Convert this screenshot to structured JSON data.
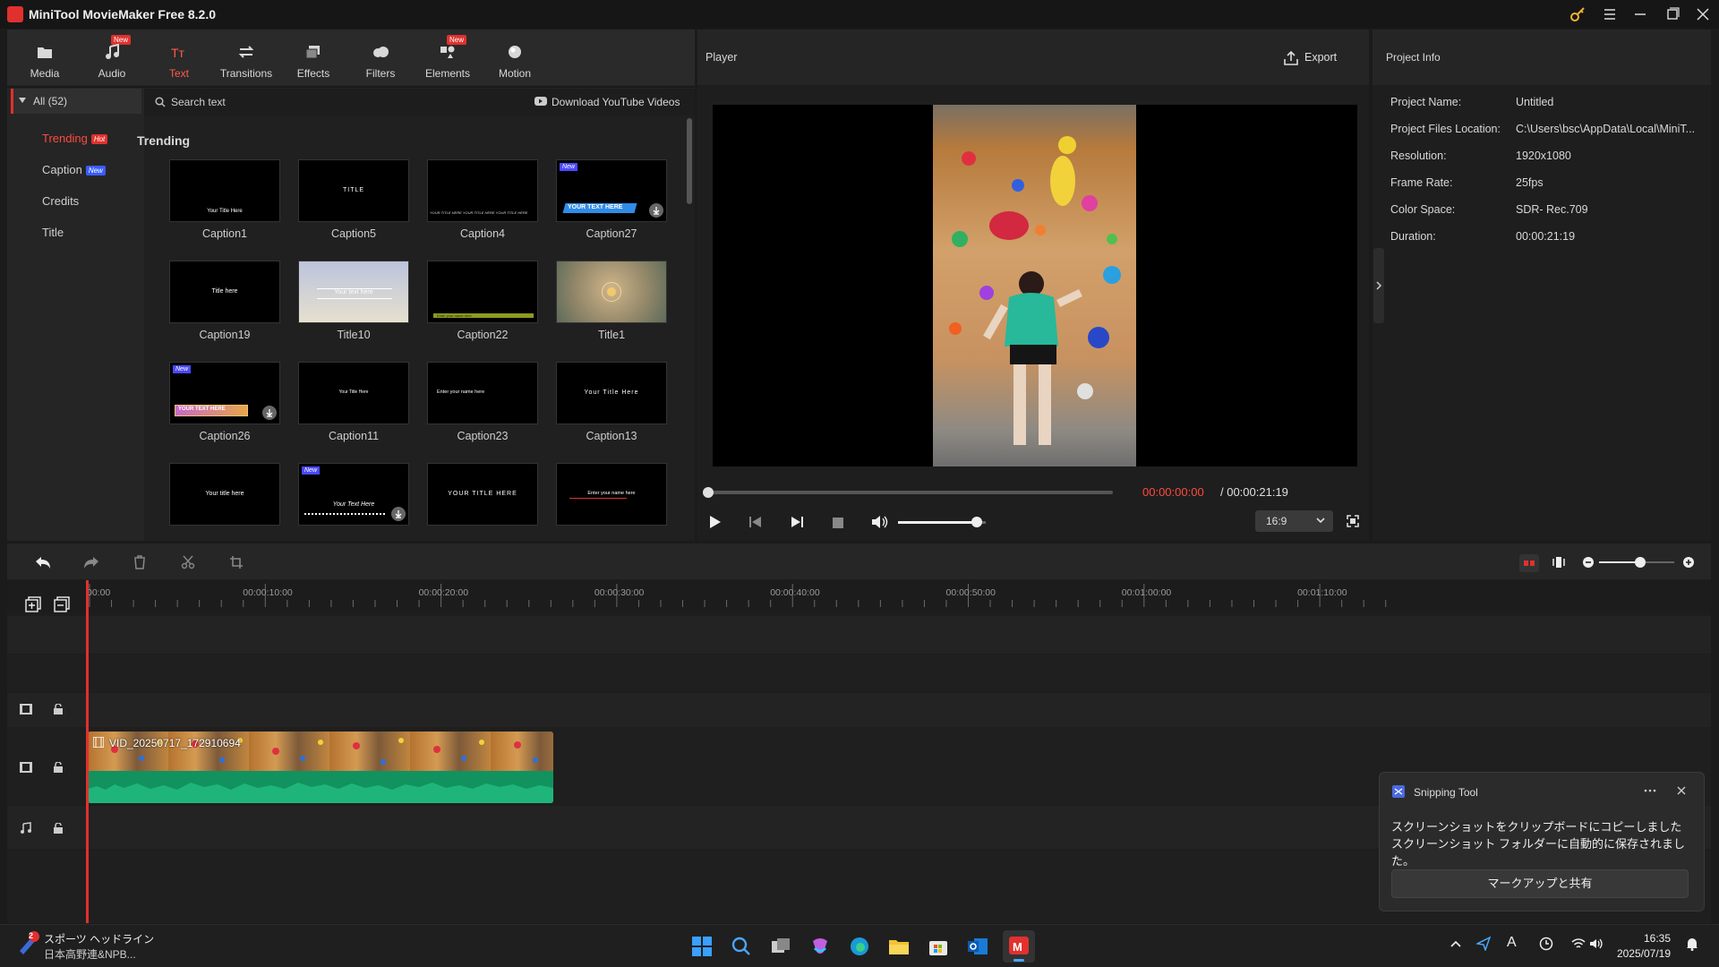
{
  "app": {
    "title": "MiniTool MovieMaker Free 8.2.0"
  },
  "toolbar": {
    "tabs": [
      {
        "label": "Media",
        "icon": "folder-icon",
        "new": false
      },
      {
        "label": "Audio",
        "icon": "music-note-icon",
        "new": true
      },
      {
        "label": "Text",
        "icon": "text-icon",
        "new": false,
        "active": true
      },
      {
        "label": "Transitions",
        "icon": "swap-arrows-icon",
        "new": false
      },
      {
        "label": "Effects",
        "icon": "layers-icon",
        "new": false
      },
      {
        "label": "Filters",
        "icon": "cloud-icon",
        "new": false
      },
      {
        "label": "Elements",
        "icon": "shapes-icon",
        "new": true
      },
      {
        "label": "Motion",
        "icon": "sphere-icon",
        "new": false
      }
    ],
    "new_badge": "New"
  },
  "library": {
    "category_all": "All (52)",
    "categories": [
      {
        "label": "Trending",
        "badge": "Hot"
      },
      {
        "label": "Caption",
        "badge": "New"
      },
      {
        "label": "Credits",
        "badge": ""
      },
      {
        "label": "Title",
        "badge": ""
      }
    ],
    "search_placeholder": "Search text",
    "download_link": "Download YouTube Videos",
    "section_heading": "Trending",
    "items": [
      {
        "label": "Caption1",
        "preview": "Your Title Here"
      },
      {
        "label": "Caption5",
        "preview": "TITLE"
      },
      {
        "label": "Caption4",
        "preview": "YOUR TITLE HERE YOUR TITLE HERE YOUR TITLE HERE"
      },
      {
        "label": "Caption27",
        "preview": "YOUR TEXT HERE",
        "new": true
      },
      {
        "label": "Caption19",
        "preview": "Title here"
      },
      {
        "label": "Title10",
        "preview": "Your text here"
      },
      {
        "label": "Caption22",
        "preview": "Enter your name here"
      },
      {
        "label": "Title1",
        "preview": ""
      },
      {
        "label": "Caption26",
        "preview": "YOUR TEXT HERE",
        "new": true
      },
      {
        "label": "Caption11",
        "preview": "Your Title Here"
      },
      {
        "label": "Caption23",
        "preview": "Enter your name here"
      },
      {
        "label": "Caption13",
        "preview": "Your Title Here"
      },
      {
        "label": "",
        "preview": "Your title here"
      },
      {
        "label": "",
        "preview": "Your Text Here",
        "new": true
      },
      {
        "label": "",
        "preview": "YOUR TITLE HERE"
      },
      {
        "label": "",
        "preview": "Enter your name here"
      }
    ],
    "new_badge": "New"
  },
  "player": {
    "title": "Player",
    "export_label": "Export",
    "current_time": "00:00:00:00",
    "total_time": "/ 00:00:21:19",
    "aspect": "16:9",
    "volume_level": 0.9,
    "progress": 0.0
  },
  "project_info": {
    "title": "Project Info",
    "rows": [
      {
        "label": "Project Name:",
        "value": "Untitled"
      },
      {
        "label": "Project Files Location:",
        "value": "C:\\Users\\bsc\\AppData\\Local\\MiniT..."
      },
      {
        "label": "Resolution:",
        "value": "1920x1080"
      },
      {
        "label": "Frame Rate:",
        "value": "25fps"
      },
      {
        "label": "Color Space:",
        "value": "SDR- Rec.709"
      },
      {
        "label": "Duration:",
        "value": "00:00:21:19"
      }
    ]
  },
  "timeline": {
    "ruler": [
      "00:00",
      "00:00:10:00",
      "00:00:20:00",
      "00:00:30:00",
      "00:00:40:00",
      "00:00:50:00",
      "00:01:00:00",
      "00:01:10:00"
    ],
    "clip_name": "VID_20250717_172910694",
    "zoom_level": 0.55
  },
  "toast": {
    "app": "Snipping Tool",
    "line1": "スクリーンショットをクリップボードにコピーしました",
    "line2": "スクリーンショット フォルダーに自動的に保存されました。",
    "button": "マークアップと共有"
  },
  "taskbar": {
    "news_title": "スポーツ ヘッドライン",
    "news_sub": "日本高野連&NPB...",
    "news_badge": "2",
    "time": "16:35",
    "date": "2025/07/19"
  },
  "colors": {
    "accent": "#e0312e",
    "timecode": "#ff4a3d",
    "waveform": "#1aa06a"
  }
}
